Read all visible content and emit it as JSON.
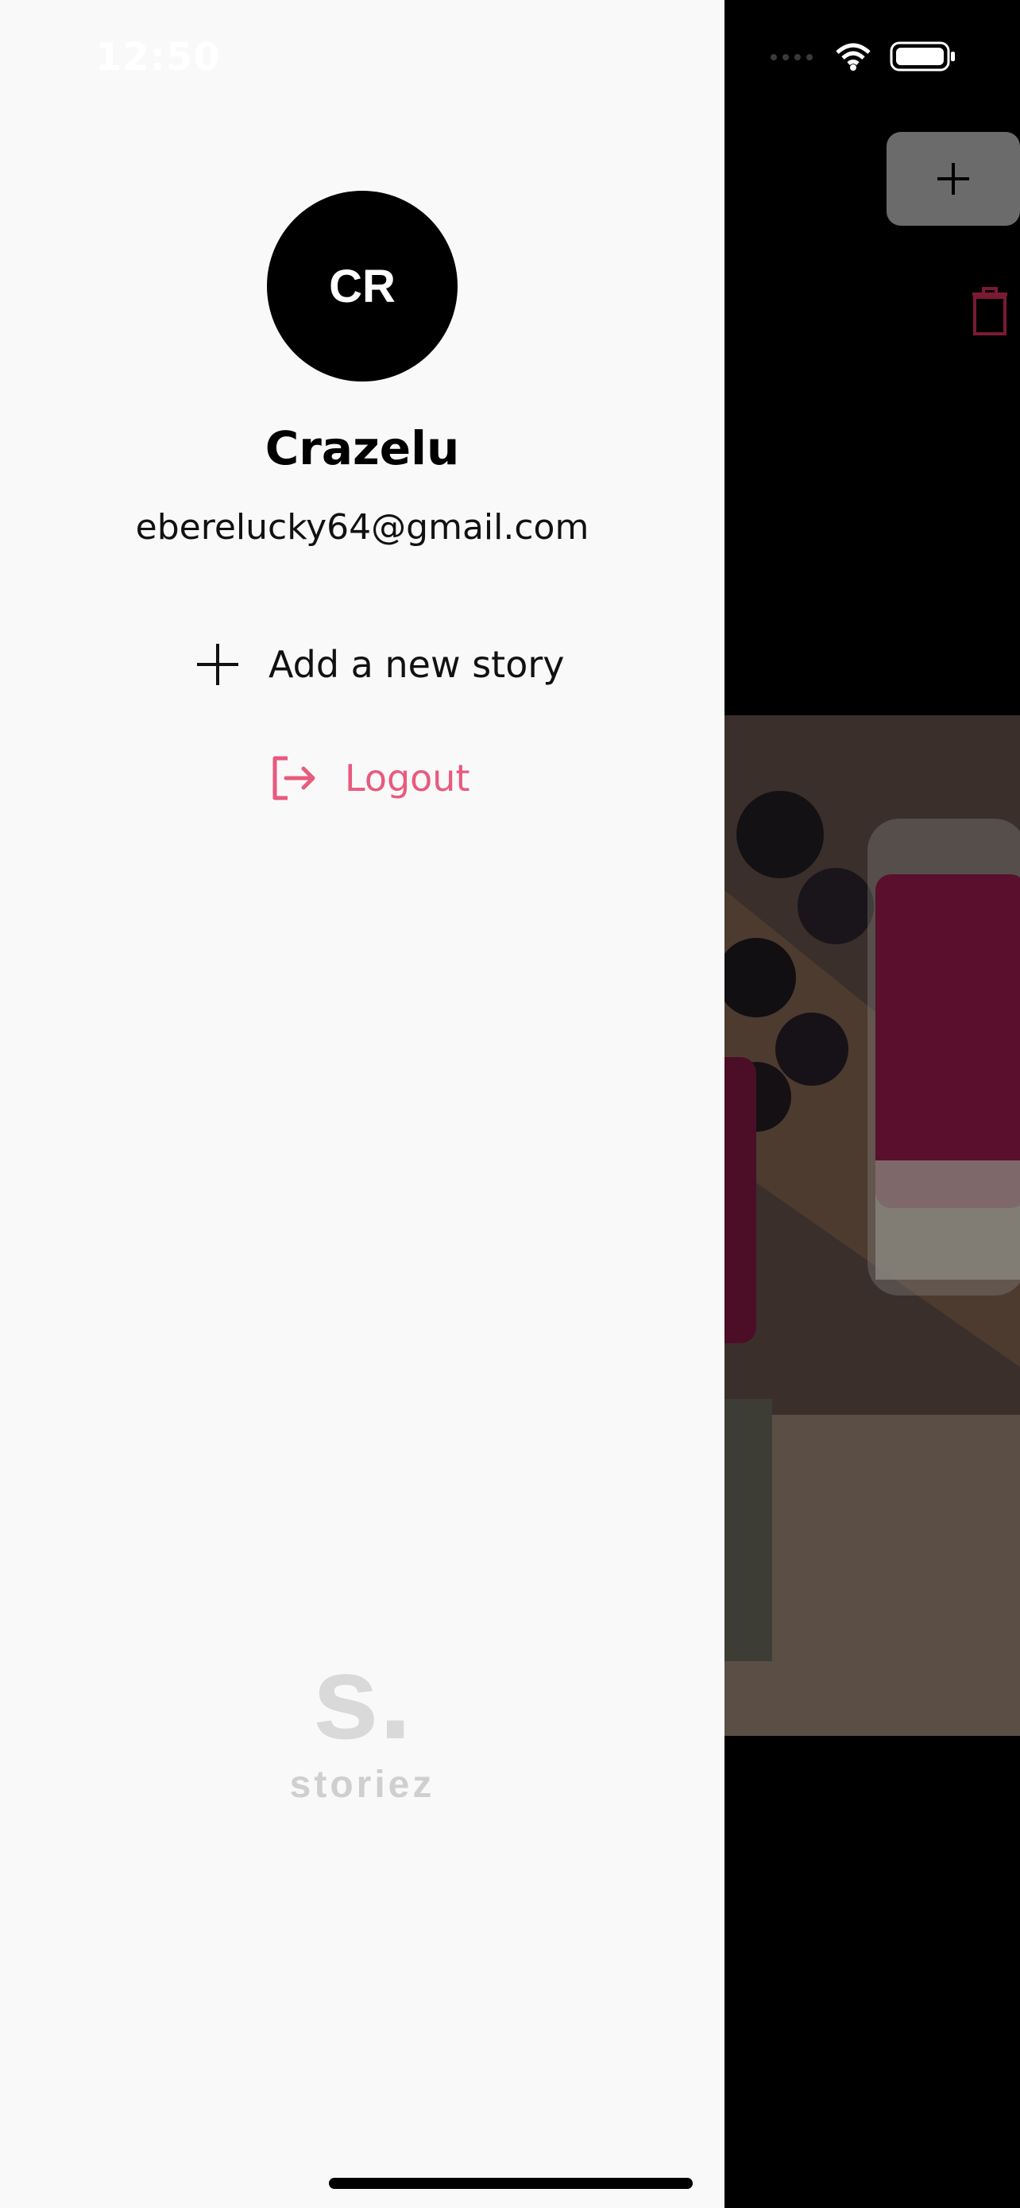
{
  "status_bar": {
    "time": "12:50"
  },
  "profile": {
    "initials": "CR",
    "name": "Crazelu",
    "email": "eberelucky64@gmail.com"
  },
  "menu": {
    "add_story_label": "Add a new story",
    "logout_label": "Logout"
  },
  "branding": {
    "logo_mark": "s.",
    "logo_word": "storiez"
  },
  "colors": {
    "drawer_bg": "#f9f9f9",
    "accent_logout": "#e85a7e",
    "avatar_bg": "#000000"
  },
  "icons": {
    "add": "plus-icon",
    "logout": "logout-icon",
    "trash": "trash-icon",
    "wifi": "wifi-icon",
    "battery": "battery-icon",
    "signal": "signal-icon"
  }
}
